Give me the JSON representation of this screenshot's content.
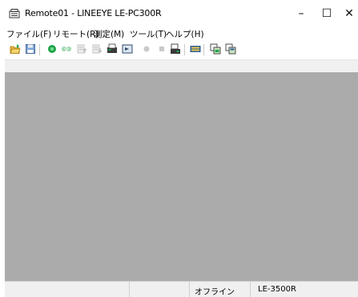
{
  "window": {
    "title": "Remote01 - LINEEYE LE-PC300R",
    "controls": {
      "minimize": "–",
      "maximize": "☐",
      "close": "✕"
    }
  },
  "menu": [
    {
      "label": "ファイル(F)"
    },
    {
      "label": "リモート(R)"
    },
    {
      "label": "測定(M)"
    },
    {
      "label": "ツール(T)"
    },
    {
      "label": "ヘルプ(H)"
    }
  ],
  "toolbar": {
    "buttons": [
      {
        "icon": "open-folder-icon"
      },
      {
        "icon": "save-icon"
      },
      {
        "icon": "connect-icon"
      },
      {
        "icon": "disconnect-icon"
      },
      {
        "icon": "upload-config-icon"
      },
      {
        "icon": "download-config-icon"
      },
      {
        "icon": "transfer-data-icon"
      },
      {
        "icon": "display-icon"
      },
      {
        "icon": "record-icon"
      },
      {
        "icon": "stop-icon"
      },
      {
        "icon": "device-settings-icon"
      },
      {
        "icon": "monitor-icon"
      },
      {
        "icon": "copy-icon"
      },
      {
        "icon": "paste-icon"
      }
    ]
  },
  "status": {
    "mode": "オフライン",
    "model": "LE-3500R"
  },
  "colors": {
    "client_background": "#ababab",
    "accent_green": "#21a34a",
    "folder_yellow": "#e9b93a",
    "save_blue": "#4f7fb8"
  }
}
